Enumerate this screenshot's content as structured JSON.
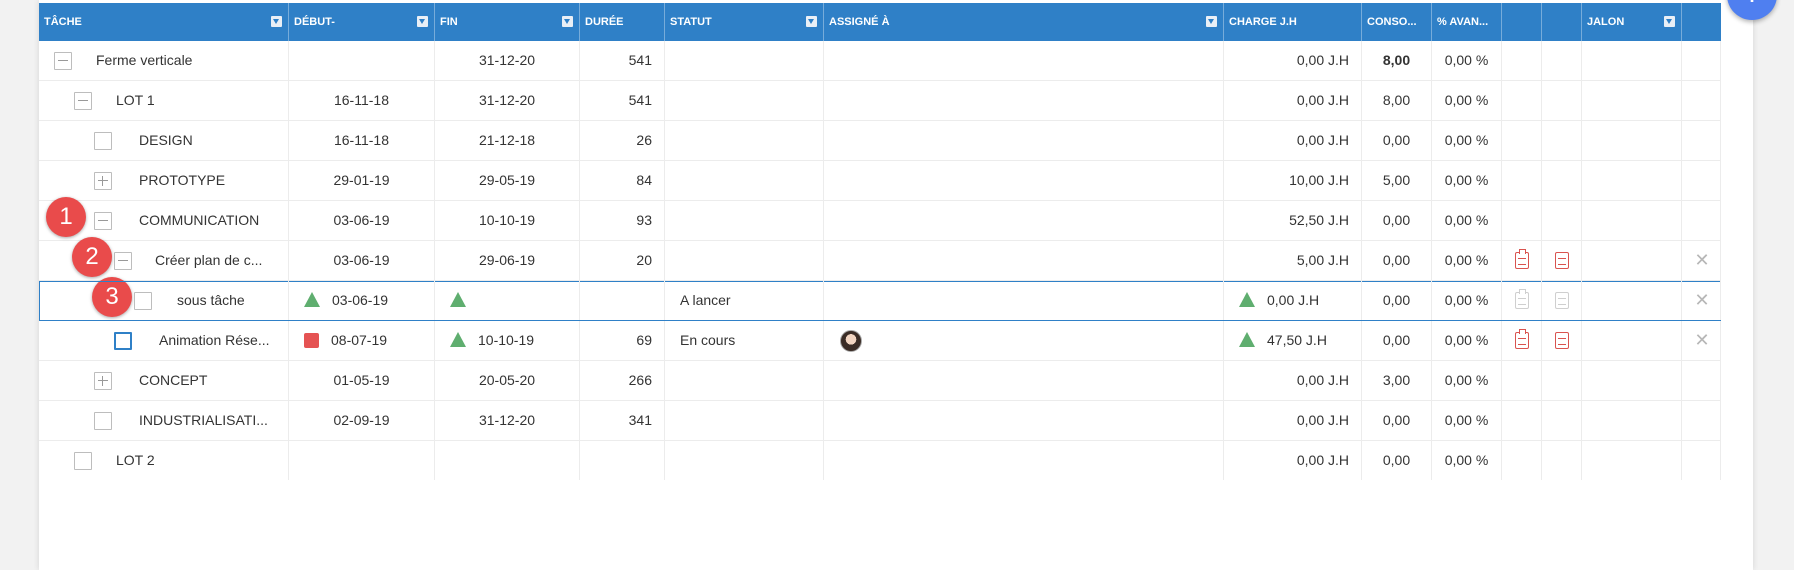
{
  "header": {
    "tache": "TÂCHE",
    "debut": "DÉBUT-",
    "fin": "FIN",
    "duree": "DURÉE",
    "statut": "STATUT",
    "assigne": "ASSIGNÉ À",
    "charge": "CHARGE J.H",
    "conso": "CONSO...",
    "avancement": "% AVAN...",
    "jalon": "JALON"
  },
  "add_button": "+",
  "badges": [
    "1",
    "2",
    "3"
  ],
  "rows": [
    {
      "name": "Ferme verticale",
      "debut": "",
      "fin": "31-12-20",
      "duree": "541",
      "statut": "",
      "charge": "0,00 J.H",
      "conso": "8,00",
      "avancement": "0,00 %"
    },
    {
      "name": "LOT 1",
      "debut": "16-11-18",
      "fin": "31-12-20",
      "duree": "541",
      "statut": "",
      "charge": "0,00 J.H",
      "conso": "8,00",
      "avancement": "0,00 %"
    },
    {
      "name": "DESIGN",
      "debut": "16-11-18",
      "fin": "21-12-18",
      "duree": "26",
      "statut": "",
      "charge": "0,00 J.H",
      "conso": "0,00",
      "avancement": "0,00 %"
    },
    {
      "name": "PROTOTYPE",
      "debut": "29-01-19",
      "fin": "29-05-19",
      "duree": "84",
      "statut": "",
      "charge": "10,00 J.H",
      "conso": "5,00",
      "avancement": "0,00 %"
    },
    {
      "name": "COMMUNICATION",
      "debut": "03-06-19",
      "fin": "10-10-19",
      "duree": "93",
      "statut": "",
      "charge": "52,50 J.H",
      "conso": "0,00",
      "avancement": "0,00 %"
    },
    {
      "name": "Créer plan de c...",
      "debut": "03-06-19",
      "fin": "29-06-19",
      "duree": "20",
      "statut": "",
      "charge": "5,00 J.H",
      "conso": "0,00",
      "avancement": "0,00 %"
    },
    {
      "name": "sous tâche",
      "debut": "03-06-19",
      "fin": "",
      "duree": "",
      "statut": "A lancer",
      "charge": "0,00 J.H",
      "conso": "0,00",
      "avancement": "0,00 %"
    },
    {
      "name": "Animation Rése...",
      "debut": "08-07-19",
      "fin": "10-10-19",
      "duree": "69",
      "statut": "En cours",
      "charge": "47,50 J.H",
      "conso": "0,00",
      "avancement": "0,00 %"
    },
    {
      "name": "CONCEPT",
      "debut": "01-05-19",
      "fin": "20-05-20",
      "duree": "266",
      "statut": "",
      "charge": "0,00 J.H",
      "conso": "3,00",
      "avancement": "0,00 %"
    },
    {
      "name": "INDUSTRIALISATI...",
      "debut": "02-09-19",
      "fin": "31-12-20",
      "duree": "341",
      "statut": "",
      "charge": "0,00 J.H",
      "conso": "0,00",
      "avancement": "0,00 %"
    },
    {
      "name": "LOT 2",
      "debut": "",
      "fin": "",
      "duree": "",
      "statut": "",
      "charge": "0,00 J.H",
      "conso": "0,00",
      "avancement": "0,00 %"
    }
  ],
  "colors": {
    "header": "#2f80c7",
    "badge": "#e94b4b",
    "fab": "#4f7ff0",
    "up_triangle": "#5fae6f",
    "red_square": "#e55353",
    "action_icons": "#d9534f"
  },
  "icons": {
    "collapse": "minus-box-icon",
    "expand": "plus-box-icon",
    "filter": "filter-icon",
    "clipboard": "clipboard-icon",
    "note": "note-icon",
    "delete": "close-icon",
    "trend_up": "triangle-up-icon",
    "alert": "red-square-icon"
  }
}
